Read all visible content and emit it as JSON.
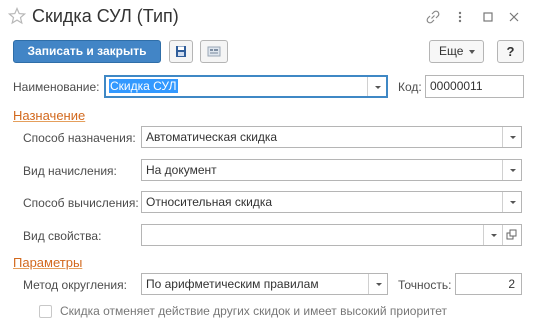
{
  "window": {
    "title": "Скидка СУЛ (Тип)"
  },
  "toolbar": {
    "save_close_label": "Записать и закрыть",
    "more_label": "Еще",
    "help_label": "?"
  },
  "name_row": {
    "label": "Наименование:",
    "value": "Скидка СУЛ",
    "code_label": "Код:",
    "code_value": "00000011"
  },
  "purpose": {
    "title": "Назначение",
    "method_label": "Способ назначения:",
    "method_value": "Автоматическая скидка",
    "accrual_label": "Вид начисления:",
    "accrual_value": "На документ",
    "calc_label": "Способ вычисления:",
    "calc_value": "Относительная скидка",
    "property_label": "Вид свойства:",
    "property_value": ""
  },
  "params": {
    "title": "Параметры",
    "rounding_label": "Метод округления:",
    "rounding_value": "По арифметическим правилам",
    "precision_label": "Точность:",
    "precision_value": "2",
    "override_label": "Скидка отменяет действие других скидок и имеет высокий приоритет",
    "override_checked": false
  },
  "colors": {
    "primary_button": "#4285c6",
    "section_title": "#d2691e",
    "focus_border": "#3f88c5"
  },
  "icons": [
    "star-icon",
    "link-icon",
    "more-vert-icon",
    "maximize-icon",
    "close-icon",
    "save-icon",
    "report-icon",
    "open-icon"
  ]
}
